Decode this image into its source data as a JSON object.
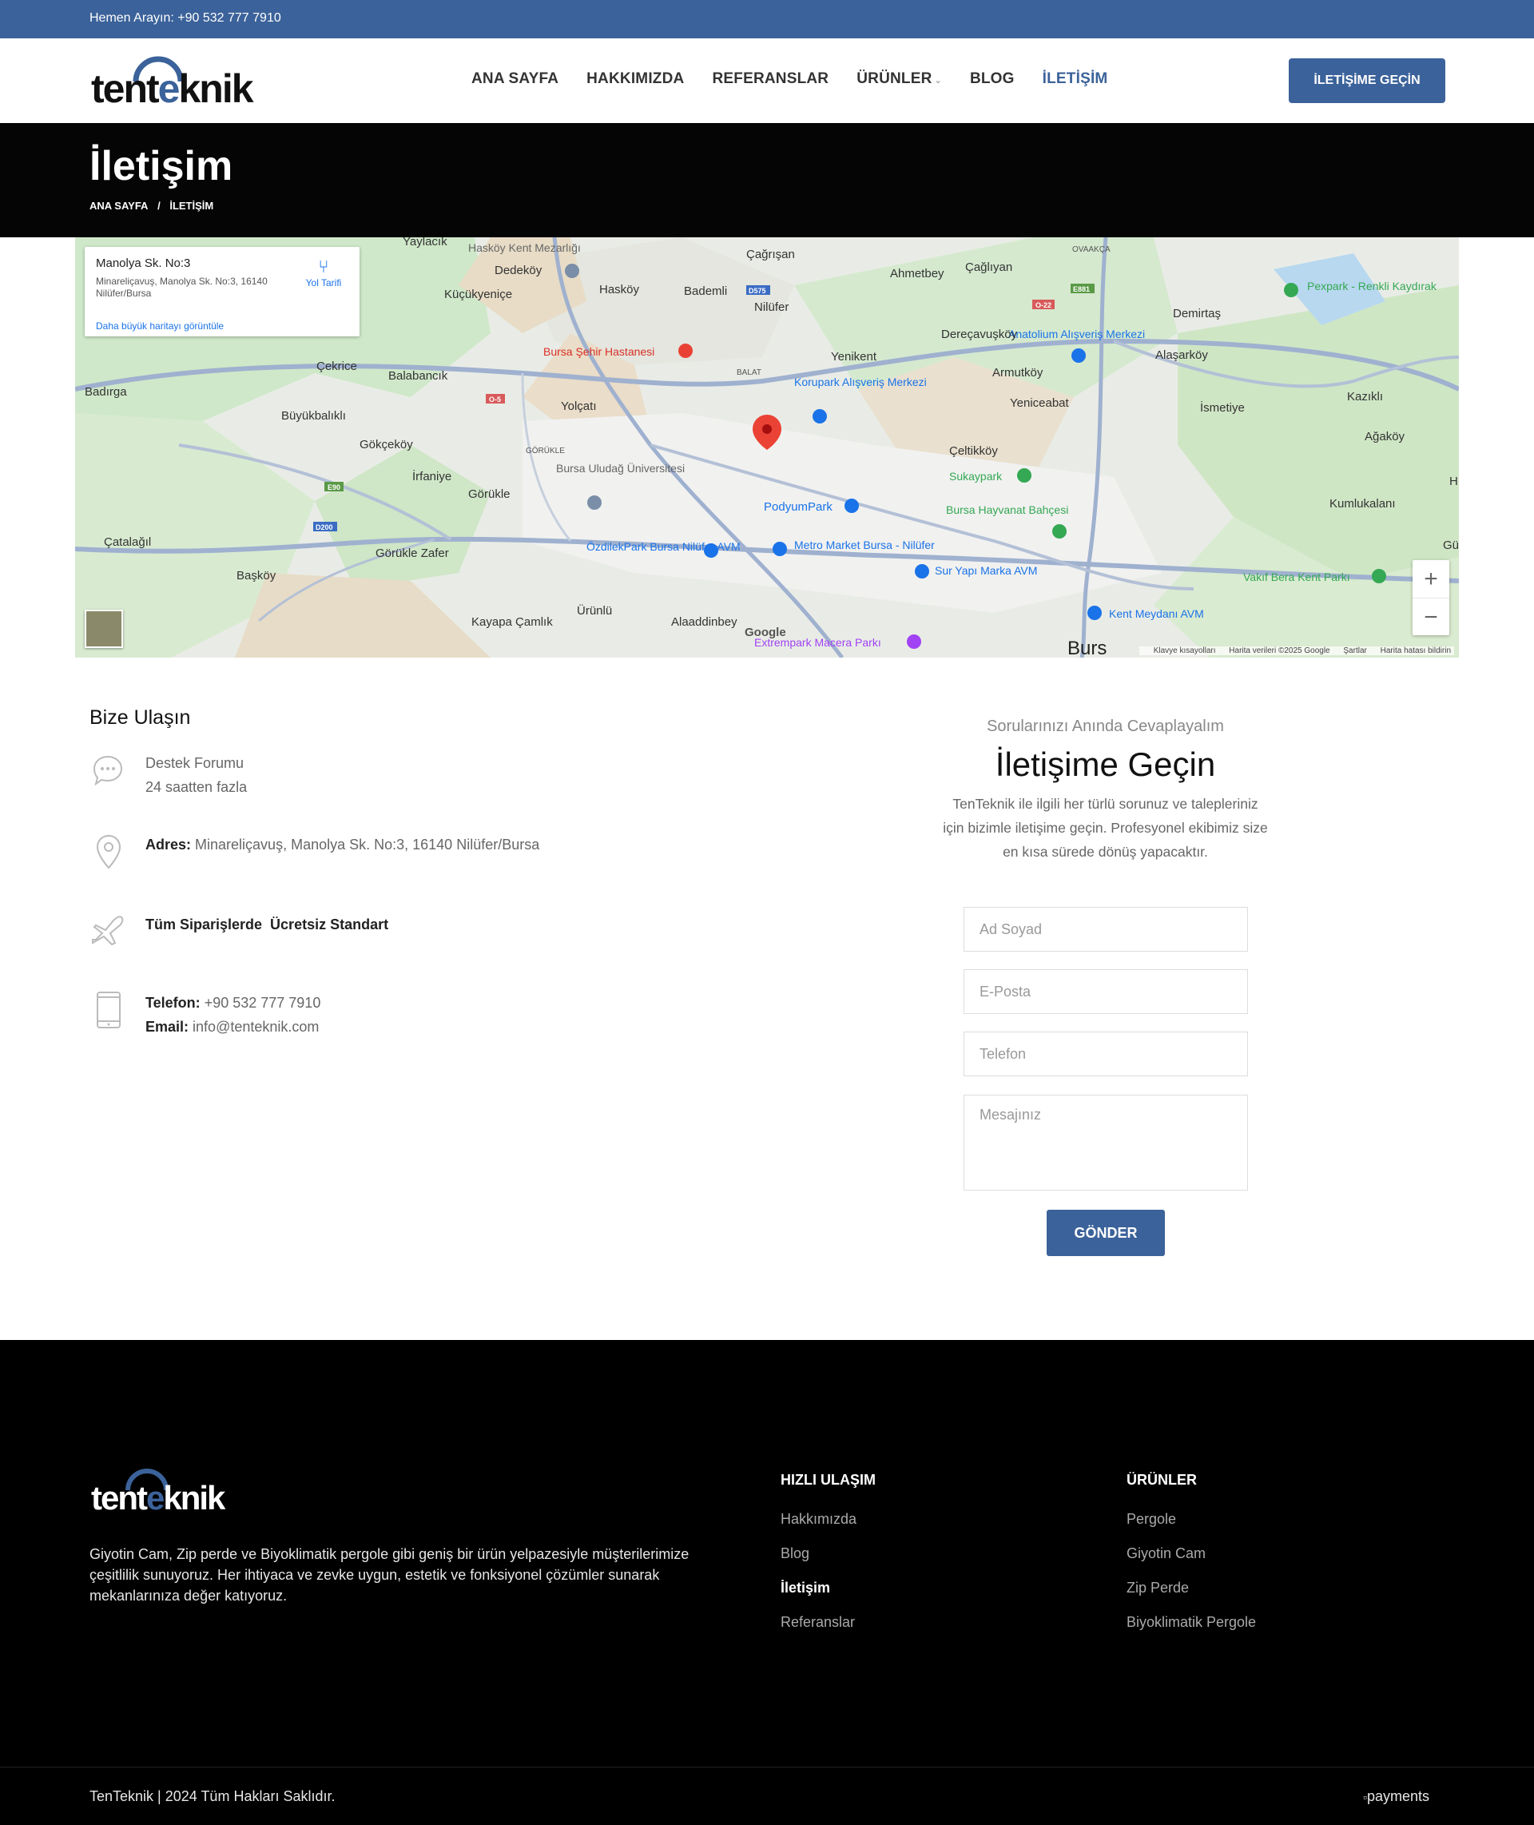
{
  "topbar": {
    "phone": "Hemen Arayın: +90 532 777 7910"
  },
  "header": {
    "logo_text_left": "tent",
    "logo_text_mid": "e",
    "logo_text_right": "knik",
    "nav": [
      {
        "label": "ANA SAYFA",
        "active": false
      },
      {
        "label": "HAKKIMIZDA",
        "active": false
      },
      {
        "label": "REFERANSLAR",
        "active": false
      },
      {
        "label": "ÜRÜNLER",
        "active": false,
        "has_dropdown": true
      },
      {
        "label": "BLOG",
        "active": false
      },
      {
        "label": "İLETİŞİM",
        "active": true
      }
    ],
    "cta_label": "İLETİŞİME GEÇİN"
  },
  "titleband": {
    "title": "İletişim",
    "breadcrumb": [
      "ANA SAYFA",
      "/",
      "İLETİŞİM"
    ]
  },
  "map": {
    "card_title": "Manolya Sk. No:3",
    "card_address": "Minareliçavuş, Manolya Sk. No:3, 16140 Nilüfer/Bursa",
    "card_link": "Daha büyük haritayı görüntüle",
    "directions_label": "Yol Tarifi",
    "zoom_in": "+",
    "zoom_out": "−",
    "google": "Google",
    "footer_items": [
      "Klavye kısayolları",
      "Harita verileri ©2025 Google",
      "Şartlar",
      "Harita hatası bildirin"
    ],
    "places": [
      "Yaylacık",
      "Hasköy Kent Mezarlığı",
      "Dedeköy",
      "Hasköy",
      "Küçükyeniçe",
      "Bademli",
      "Çağrışan",
      "Nilüfer",
      "Ahmetbey",
      "Çağlıyan",
      "OVAAKÇA",
      "Demirtaş",
      "Pexpark - Renkli Kaydırak",
      "Anatolium Alışveriş Merkezi",
      "Dereçavuşköy",
      "Alaşarköy",
      "Bursa Şehir Hastanesi",
      "Yenikent",
      "BALAT",
      "Korupark Alışveriş Merkezi",
      "Armutköy",
      "Kazıklı",
      "İsmetiye",
      "Yeniceabat",
      "Çekrice",
      "Balabancık",
      "Badırga",
      "Yolçatı",
      "Büyükbalıklı",
      "Gökçeköy",
      "GÖRÜKLE",
      "Bursa Uludağ Üniversitesi",
      "Çeltikköy",
      "Ağaköy",
      "Sukaypark",
      "İrfaniye",
      "Görükle",
      "PodyumPark",
      "Bursa Hayvanat Bahçesi",
      "Kumlukalanı",
      "Çatalağıl",
      "Görükle Zafer",
      "ÖzdilekPark Bursa Nilüfer AVM",
      "Metro Market Bursa - Nilüfer",
      "Başköy",
      "Sur Yapı Marka AVM",
      "Vakıf Bera Kent Parkı",
      "Ürünlü",
      "Alaaddinbey",
      "Kayapa Çamlık",
      "Kent Meydanı AVM",
      "Extrempark Macera Parkı",
      "Burs",
      "H",
      "Gü"
    ],
    "road_labels": [
      "D575",
      "E881",
      "O-22",
      "O-5",
      "E90",
      "D200"
    ]
  },
  "contact": {
    "heading": "Bize Ulaşın",
    "support_title": "Destek Forumu",
    "support_sub": "24 saatten fazla",
    "address_label": "Adres:",
    "address_value": "Minareliçavuş, Manolya Sk. No:3, 16140 Nilüfer/Bursa",
    "shipping": "Tüm Siparişlerde  Ücretsiz Standart",
    "phone_label": "Telefon:",
    "phone_value": "+90 532 777 7910",
    "email_label": "Email:",
    "email_value": "info@tenteknik.com"
  },
  "form": {
    "subtitle": "Sorularınızı Anında Cevaplayalım",
    "title": "İletişime Geçin",
    "description": "TenTeknik ile ilgili her türlü sorunuz ve talepleriniz için bizimle iletişime geçin. Profesyonel ekibimiz size en kısa sürede dönüş yapacaktır.",
    "name_placeholder": "Ad Soyad",
    "email_placeholder": "E-Posta",
    "phone_placeholder": "Telefon",
    "message_placeholder": "Mesajınız",
    "submit_label": "GÖNDER"
  },
  "footer": {
    "description": "Giyotin Cam, Zip perde ve Biyoklimatik pergole gibi geniş bir ürün yelpazesiyle müşterilerimize çeşitlilik sunuyoruz. Her ihtiyaca ve zevke uygun, estetik ve fonksiyonel çözümler sunarak mekanlarınıza değer katıyoruz.",
    "quick_title": "HIZLI ULAŞIM",
    "quick_links": [
      {
        "label": "Hakkımızda",
        "active": false
      },
      {
        "label": "Blog",
        "active": false
      },
      {
        "label": "İletişim",
        "active": true
      },
      {
        "label": "Referanslar",
        "active": false
      }
    ],
    "products_title": "ÜRÜNLER",
    "product_links": [
      "Pergole",
      "Giyotin Cam",
      "Zip Perde",
      "Biyoklimatik Pergole"
    ],
    "copyright": "TenTeknik | 2024 Tüm Hakları Saklıdır.",
    "payments_alt": "payments"
  },
  "colors": {
    "brand": "#3b629a",
    "footer_bg": "#000000",
    "title_band": "#050505"
  }
}
